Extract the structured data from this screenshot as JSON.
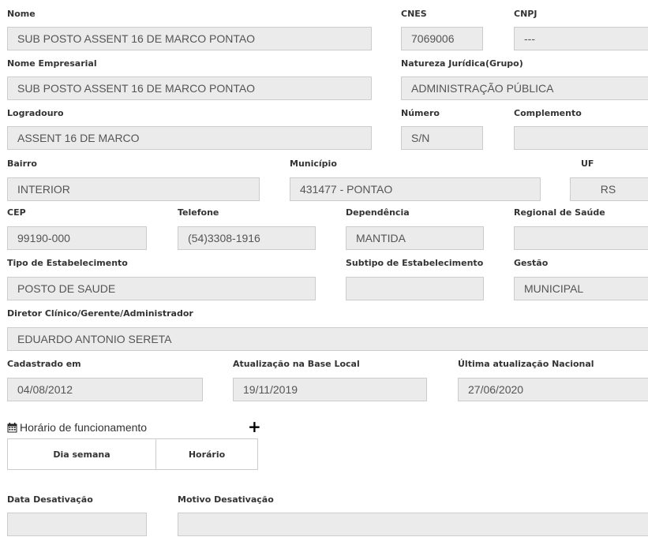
{
  "fields": {
    "nome": {
      "label": "Nome",
      "value": "SUB POSTO ASSENT 16 DE MARCO PONTAO"
    },
    "cnes": {
      "label": "CNES",
      "value": "7069006"
    },
    "cnpj": {
      "label": "CNPJ",
      "value": "---"
    },
    "nome_empresarial": {
      "label": "Nome Empresarial",
      "value": "SUB POSTO ASSENT 16 DE MARCO PONTAO"
    },
    "natureza_juridica": {
      "label": "Natureza Jurídica(Grupo)",
      "value": "ADMINISTRAÇÃO PÚBLICA"
    },
    "logradouro": {
      "label": "Logradouro",
      "value": "ASSENT 16 DE MARCO"
    },
    "numero": {
      "label": "Número",
      "value": "S/N"
    },
    "complemento": {
      "label": "Complemento",
      "value": ""
    },
    "bairro": {
      "label": "Bairro",
      "value": "INTERIOR"
    },
    "municipio": {
      "label": "Município",
      "value": "431477 - PONTAO"
    },
    "uf": {
      "label": "UF",
      "value": "RS"
    },
    "cep": {
      "label": "CEP",
      "value": "99190-000"
    },
    "telefone": {
      "label": "Telefone",
      "value": "(54)3308-1916"
    },
    "dependencia": {
      "label": "Dependência",
      "value": "MANTIDA"
    },
    "regional_saude": {
      "label": "Regional de Saúde",
      "value": ""
    },
    "tipo_estabelecimento": {
      "label": "Tipo de Estabelecimento",
      "value": "POSTO DE SAUDE"
    },
    "subtipo_estabelecimento": {
      "label": "Subtipo de Estabelecimento",
      "value": ""
    },
    "gestao": {
      "label": "Gestão",
      "value": "MUNICIPAL"
    },
    "diretor": {
      "label": "Diretor Clínico/Gerente/Administrador",
      "value": "EDUARDO ANTONIO SERETA"
    },
    "cadastrado_em": {
      "label": "Cadastrado em",
      "value": "04/08/2012"
    },
    "atualizacao_base_local": {
      "label": "Atualização na Base Local",
      "value": "19/11/2019"
    },
    "ultima_atualizacao_nacional": {
      "label": "Última atualização Nacional",
      "value": "27/06/2020"
    },
    "data_desativacao": {
      "label": "Data Desativação",
      "value": ""
    },
    "motivo_desativacao": {
      "label": "Motivo Desativação",
      "value": ""
    }
  },
  "horario": {
    "title": "Horário de funcionamento",
    "icon": "calendar-icon",
    "add_icon": "plus-icon",
    "add_symbol": "+",
    "columns": [
      "Dia semana",
      "Horário"
    ]
  },
  "colors": {
    "field_bg": "#ebebeb",
    "field_border": "#cccccc",
    "label": "#333333"
  }
}
